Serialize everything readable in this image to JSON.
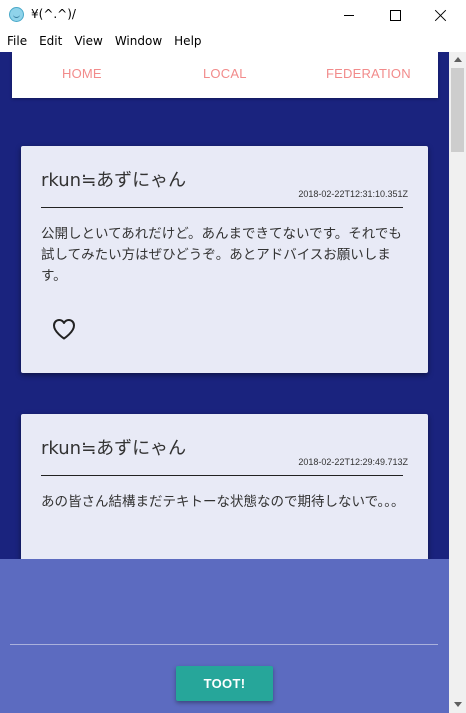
{
  "window": {
    "title": "¥(^.^)/",
    "icon": "app-logo-icon",
    "controls": [
      "minimize-icon",
      "maximize-icon",
      "close-icon"
    ]
  },
  "menu": {
    "items": [
      "File",
      "Edit",
      "View",
      "Window",
      "Help"
    ]
  },
  "nav": {
    "home": "HOME",
    "local": "LOCAL",
    "federation": "FEDERATION",
    "link_color": "#f28b8b"
  },
  "posts": [
    {
      "author": "rkun≒あずにゃん",
      "timestamp": "2018-02-22T12:31:10.351Z",
      "body": "公開しといてあれだけど。あんまできてないです。それでも試してみたい方はぜひどうぞ。あとアドバイスお願いします。",
      "action_icon": "heart-icon"
    },
    {
      "author": "rkun≒あずにゃん",
      "timestamp": "2018-02-22T12:29:49.713Z",
      "body": "あの皆さん結構まだテキトーな状態なので期待しないで。。。"
    }
  ],
  "compose": {
    "toot_label": "TOOT!",
    "button_color": "#26a69a"
  },
  "colors": {
    "background": "#1a237e",
    "card": "#e8eaf6",
    "compose_panel": "#5c6bc0"
  }
}
